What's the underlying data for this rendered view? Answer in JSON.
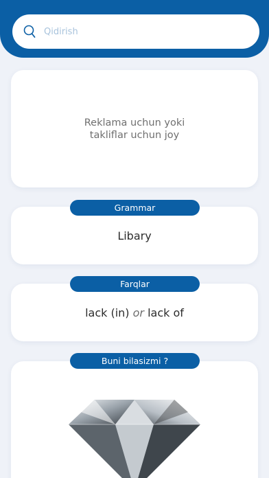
{
  "search": {
    "placeholder": "Qidirish"
  },
  "ad": {
    "text": "Reklama uchun yoki\n takliflar uchun joy"
  },
  "grammar": {
    "label": "Grammar",
    "word": "Libary"
  },
  "differences": {
    "label": "Farqlar",
    "word_a": "lack (in)",
    "connector": "or",
    "word_b": "lack of"
  },
  "did_you_know": {
    "label": "Buni bilasizmi ?",
    "image": "diamond"
  },
  "colors": {
    "brand": "#0b5fa5",
    "background": "#eff2f8",
    "card": "#ffffff"
  }
}
